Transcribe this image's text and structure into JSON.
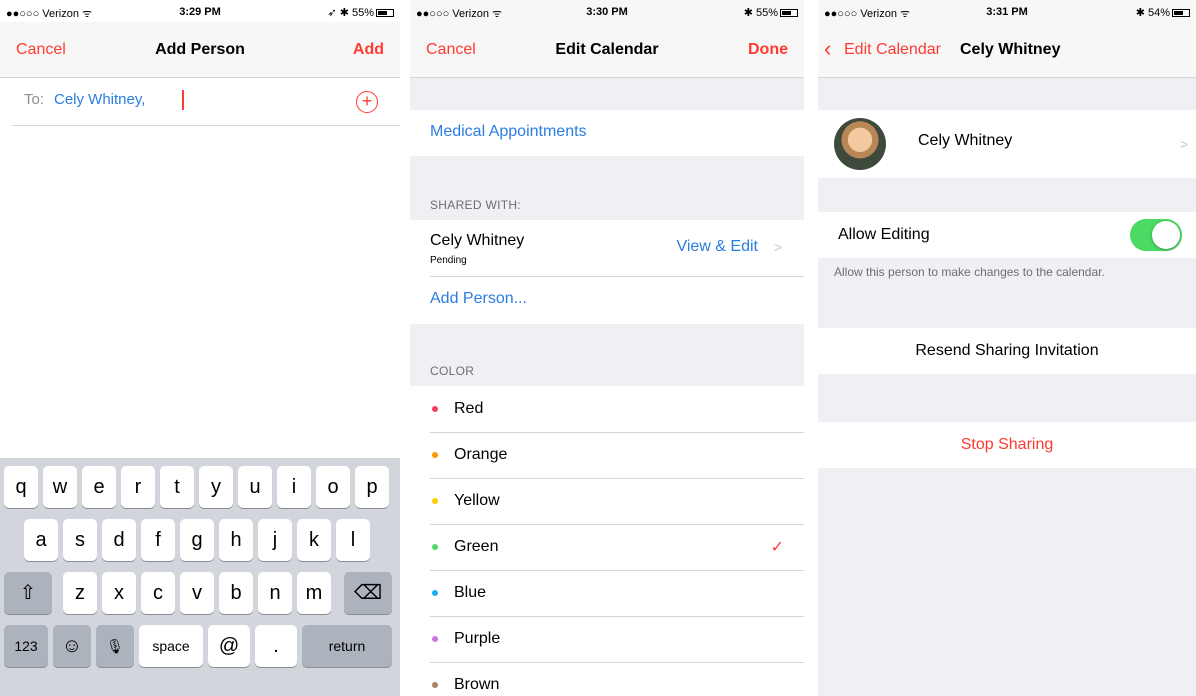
{
  "screen1": {
    "status": {
      "carrier": "●●○○○ Verizon ᯤ",
      "time": "3:29 PM",
      "battery": "➶ ✱ 55%"
    },
    "nav": {
      "left": "Cancel",
      "title": "Add Person",
      "right": "Add"
    },
    "to_label": "To:",
    "recipient": "Cely Whitney,",
    "add_icon_glyph": "+",
    "keyboard": {
      "row1": [
        "q",
        "w",
        "e",
        "r",
        "t",
        "y",
        "u",
        "i",
        "o",
        "p"
      ],
      "row2": [
        "a",
        "s",
        "d",
        "f",
        "g",
        "h",
        "j",
        "k",
        "l"
      ],
      "row3": [
        "z",
        "x",
        "c",
        "v",
        "b",
        "n",
        "m"
      ],
      "shift": "⇧",
      "delete": "⌫",
      "num": "123",
      "emoji": "☺",
      "mic": "🎙",
      "space": "space",
      "at": "@",
      "dot": ".",
      "return": "return"
    }
  },
  "screen2": {
    "status": {
      "carrier": "●●○○○ Verizon ᯤ",
      "time": "3:30 PM",
      "battery": "✱ 55%"
    },
    "nav": {
      "left": "Cancel",
      "title": "Edit Calendar",
      "right": "Done"
    },
    "calendar_name": "Medical Appointments",
    "shared_header": "SHARED WITH:",
    "shared_person": {
      "name": "Cely Whitney",
      "status": "Pending",
      "permission": "View & Edit"
    },
    "add_person": "Add Person...",
    "color_header": "COLOR",
    "colors": [
      {
        "name": "Red",
        "hex": "#fe3b5f",
        "selected": false
      },
      {
        "name": "Orange",
        "hex": "#ff9500",
        "selected": false
      },
      {
        "name": "Yellow",
        "hex": "#ffcc00",
        "selected": false
      },
      {
        "name": "Green",
        "hex": "#4cd964",
        "selected": true
      },
      {
        "name": "Blue",
        "hex": "#1badf8",
        "selected": false
      },
      {
        "name": "Purple",
        "hex": "#cc73e1",
        "selected": false
      },
      {
        "name": "Brown",
        "hex": "#a2845e",
        "selected": false
      }
    ],
    "check_glyph": "✓"
  },
  "screen3": {
    "status": {
      "carrier": "●●○○○ Verizon ᯤ",
      "time": "3:31 PM",
      "battery": "✱ 54%"
    },
    "nav": {
      "back": "Edit Calendar",
      "title": "Cely Whitney"
    },
    "person_name": "Cely Whitney",
    "allow_editing": "Allow Editing",
    "allow_editing_desc": "Allow this person to make changes to the calendar.",
    "allow_editing_on": true,
    "resend": "Resend Sharing Invitation",
    "stop": "Stop Sharing"
  },
  "colors": {
    "accent": "#fe3b30",
    "link": "#2a7de1",
    "toggle_on": "#4cd964"
  }
}
